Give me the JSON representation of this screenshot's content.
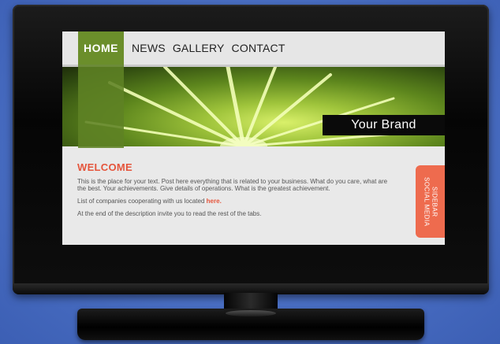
{
  "nav": {
    "home_label": "HOME",
    "items": [
      {
        "label": "NEWS"
      },
      {
        "label": "GALLERY"
      },
      {
        "label": "CONTACT"
      }
    ]
  },
  "hero": {
    "brand": "Your Brand"
  },
  "content": {
    "heading": "WELCOME",
    "paragraph1": "This is the place for your text. Post here everything that is related to your business. What do you care, what are the best. Your achievements. Give details of operations. What is the greatest achievement.",
    "paragraph2_prefix": "List of companies cooperating with us located ",
    "paragraph2_link": "here",
    "paragraph2_suffix": ".",
    "paragraph3": "At the end of the description invite you to read the rest of the tabs."
  },
  "sidebar": {
    "line1": "SIDEBAR",
    "line2": "SOCIAL MEDIA"
  },
  "colors": {
    "accent_green": "#6b8e2b",
    "accent_orange": "#ee6b4e",
    "backdrop_blue": "#4a6fc4"
  }
}
